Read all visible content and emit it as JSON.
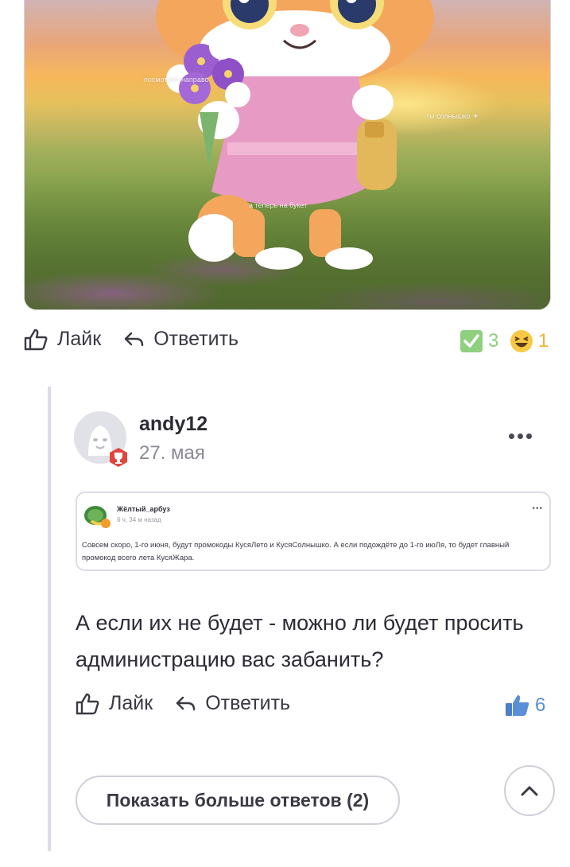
{
  "post_image": {
    "overlay_texts": [
      "посмотрел направо",
      "ты солнышко ☀",
      "а теперь на букет"
    ]
  },
  "post_actions": {
    "like_label": "Лайк",
    "reply_label": "Ответить",
    "reactions": [
      {
        "icon": "check-emoji-icon",
        "count": "3",
        "color": "#7fc97a"
      },
      {
        "icon": "laughing-emoji-icon",
        "count": "1",
        "color": "#f2b233"
      }
    ]
  },
  "reply": {
    "username": "andy12",
    "date": "27. мая",
    "quote": {
      "author": "Жёлтый_арбуз",
      "time": "6 ч, 34 м назад",
      "text": "Совсем скоро, 1-го июня, будут промокоды КусяЛето и КусяСолнышко. А если подождёте до 1-го июЛя, то будет главный промокод всего лета КусяЖара."
    },
    "body": "А если их не будет - можно ли будет просить администрацию вас забанить?",
    "like_label": "Лайк",
    "reply_label": "Ответить",
    "thumbs_count": "6",
    "thumbs_color": "#5a8fd6"
  },
  "show_more_label": "Показать больше ответов (2)"
}
